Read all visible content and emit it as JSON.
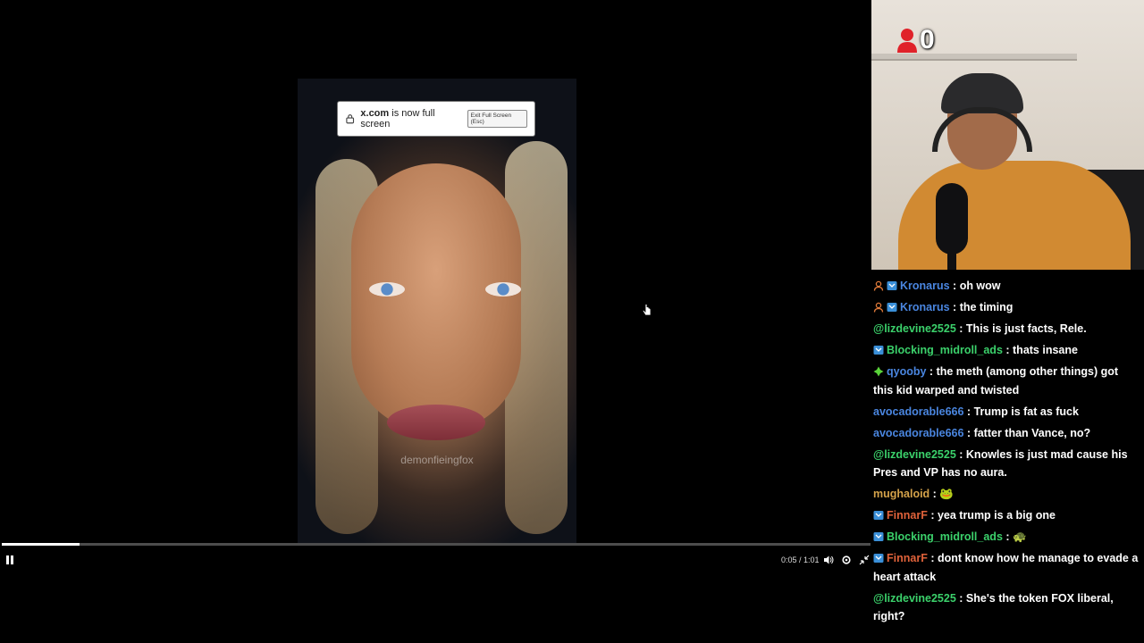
{
  "fullscreen_notice": {
    "domain": "x.com",
    "message": "is now full screen",
    "exit_button": "Exit Full Screen (Esc)"
  },
  "video": {
    "watermark": "demonfieingfox",
    "time": "0:05 / 1:01",
    "progress_fraction": 0.09
  },
  "webcam": {
    "viewer_count": "0"
  },
  "colors": {
    "blue_user": "#4a86e0",
    "green_user": "#3bd16b",
    "orange_user": "#d8903a",
    "red_user": "#e0623a",
    "tan_user": "#d4a24a"
  },
  "chat": [
    {
      "user": "Kronarus",
      "text": "oh wow",
      "color": "#4a86e0",
      "badges": [
        "person-icon",
        "tv-badge-icon"
      ]
    },
    {
      "user": "Kronarus",
      "text": "the timing",
      "color": "#4a86e0",
      "badges": [
        "person-icon",
        "tv-badge-icon"
      ]
    },
    {
      "user": "@lizdevine2525",
      "text": "This is just facts, Rele.",
      "color": "#3bd16b",
      "badges": []
    },
    {
      "user": "Blocking_midroll_ads",
      "text": "thats insane",
      "color": "#3bd16b",
      "badges": [
        "tv-badge-icon"
      ]
    },
    {
      "user": "qyooby",
      "text": "the meth (among other things) got this kid warped and twisted",
      "color": "#4a86e0",
      "badges": [
        "gem-icon"
      ]
    },
    {
      "user": "avocadorable666",
      "text": "Trump is fat as fuck",
      "color": "#4a86e0",
      "badges": []
    },
    {
      "user": "avocadorable666",
      "text": "fatter than Vance, no?",
      "color": "#4a86e0",
      "badges": []
    },
    {
      "user": "@lizdevine2525",
      "text": "Knowles is just mad cause his Pres and VP has no aura.",
      "color": "#3bd16b",
      "badges": []
    },
    {
      "user": "mughaloid",
      "text": "🐸",
      "color": "#d4a24a",
      "badges": []
    },
    {
      "user": "FinnarF",
      "text": "yea trump is a big one",
      "color": "#e0623a",
      "badges": [
        "tv-badge-icon"
      ]
    },
    {
      "user": "Blocking_midroll_ads",
      "text": "🐢",
      "color": "#3bd16b",
      "badges": [
        "tv-badge-icon"
      ]
    },
    {
      "user": "FinnarF",
      "text": "dont know how he manage to evade a heart attack",
      "color": "#e0623a",
      "badges": [
        "tv-badge-icon"
      ]
    },
    {
      "user": "@lizdevine2525",
      "text": "She's the token FOX liberal, right?",
      "color": "#3bd16b",
      "badges": []
    }
  ]
}
